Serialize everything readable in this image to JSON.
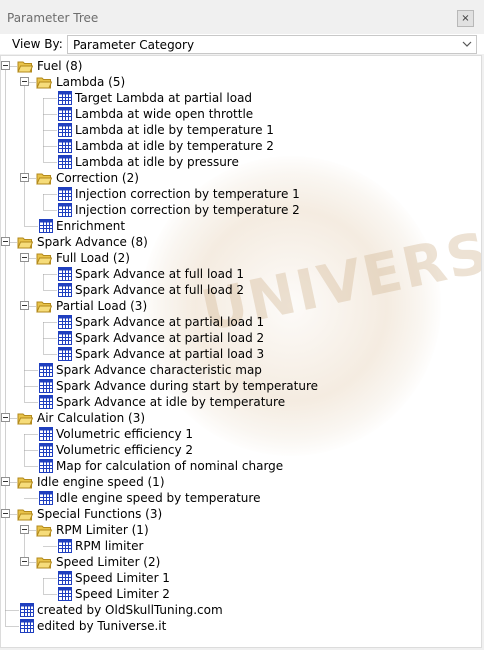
{
  "window": {
    "title": "Parameter Tree",
    "close_glyph": "×"
  },
  "view_by": {
    "label": "View By:",
    "selected": "Parameter Category"
  },
  "tree": [
    {
      "depth": 0,
      "type": "folder",
      "label": "Fuel (8)"
    },
    {
      "depth": 1,
      "type": "folder",
      "label": "Lambda (5)"
    },
    {
      "depth": 2,
      "type": "map",
      "label": "Target Lambda at partial load"
    },
    {
      "depth": 2,
      "type": "map",
      "label": "Lambda at wide open throttle"
    },
    {
      "depth": 2,
      "type": "map",
      "label": "Lambda at idle by temperature 1"
    },
    {
      "depth": 2,
      "type": "map",
      "label": "Lambda at idle by temperature 2"
    },
    {
      "depth": 2,
      "type": "map",
      "label": "Lambda at idle by pressure"
    },
    {
      "depth": 1,
      "type": "folder",
      "label": "Correction (2)"
    },
    {
      "depth": 2,
      "type": "map",
      "label": "Injection correction by temperature 1"
    },
    {
      "depth": 2,
      "type": "map",
      "label": "Injection correction by temperature 2"
    },
    {
      "depth": 1,
      "type": "map",
      "label": "Enrichment"
    },
    {
      "depth": 0,
      "type": "folder",
      "label": "Spark Advance (8)"
    },
    {
      "depth": 1,
      "type": "folder",
      "label": "Full Load (2)"
    },
    {
      "depth": 2,
      "type": "map",
      "label": "Spark Advance at full load 1"
    },
    {
      "depth": 2,
      "type": "map",
      "label": "Spark Advance at full load 2"
    },
    {
      "depth": 1,
      "type": "folder",
      "label": "Partial Load (3)"
    },
    {
      "depth": 2,
      "type": "map",
      "label": "Spark Advance at partial load 1"
    },
    {
      "depth": 2,
      "type": "map",
      "label": "Spark Advance at partial load 2"
    },
    {
      "depth": 2,
      "type": "map",
      "label": "Spark Advance at partial load 3"
    },
    {
      "depth": 1,
      "type": "map",
      "label": "Spark Advance characteristic map"
    },
    {
      "depth": 1,
      "type": "map",
      "label": "Spark Advance during start by temperature"
    },
    {
      "depth": 1,
      "type": "map",
      "label": "Spark Advance at idle by temperature"
    },
    {
      "depth": 0,
      "type": "folder",
      "label": "Air Calculation (3)"
    },
    {
      "depth": 1,
      "type": "map",
      "label": "Volumetric efficiency 1"
    },
    {
      "depth": 1,
      "type": "map",
      "label": "Volumetric efficiency 2"
    },
    {
      "depth": 1,
      "type": "map",
      "label": "Map for calculation of nominal charge"
    },
    {
      "depth": 0,
      "type": "folder",
      "label": "Idle engine speed (1)"
    },
    {
      "depth": 1,
      "type": "map",
      "label": "Idle engine speed by temperature"
    },
    {
      "depth": 0,
      "type": "folder",
      "label": "Special Functions (3)"
    },
    {
      "depth": 1,
      "type": "folder",
      "label": "RPM Limiter (1)"
    },
    {
      "depth": 2,
      "type": "map",
      "label": "RPM limiter"
    },
    {
      "depth": 1,
      "type": "folder",
      "label": "Speed Limiter (2)"
    },
    {
      "depth": 2,
      "type": "map",
      "label": "Speed Limiter 1"
    },
    {
      "depth": 2,
      "type": "map",
      "label": "Speed Limiter 2"
    },
    {
      "depth": 0,
      "type": "map",
      "label": "created by OldSkullTuning.com"
    },
    {
      "depth": 0,
      "type": "map",
      "label": "edited by Tuniverse.it"
    }
  ],
  "watermark": {
    "text": "UNIVERSE"
  },
  "colors": {
    "folder": "#e8c34a",
    "folder_dark": "#b38a1c",
    "map_grid": "#1f3fbf",
    "tree_line": "#a0a0a0"
  }
}
